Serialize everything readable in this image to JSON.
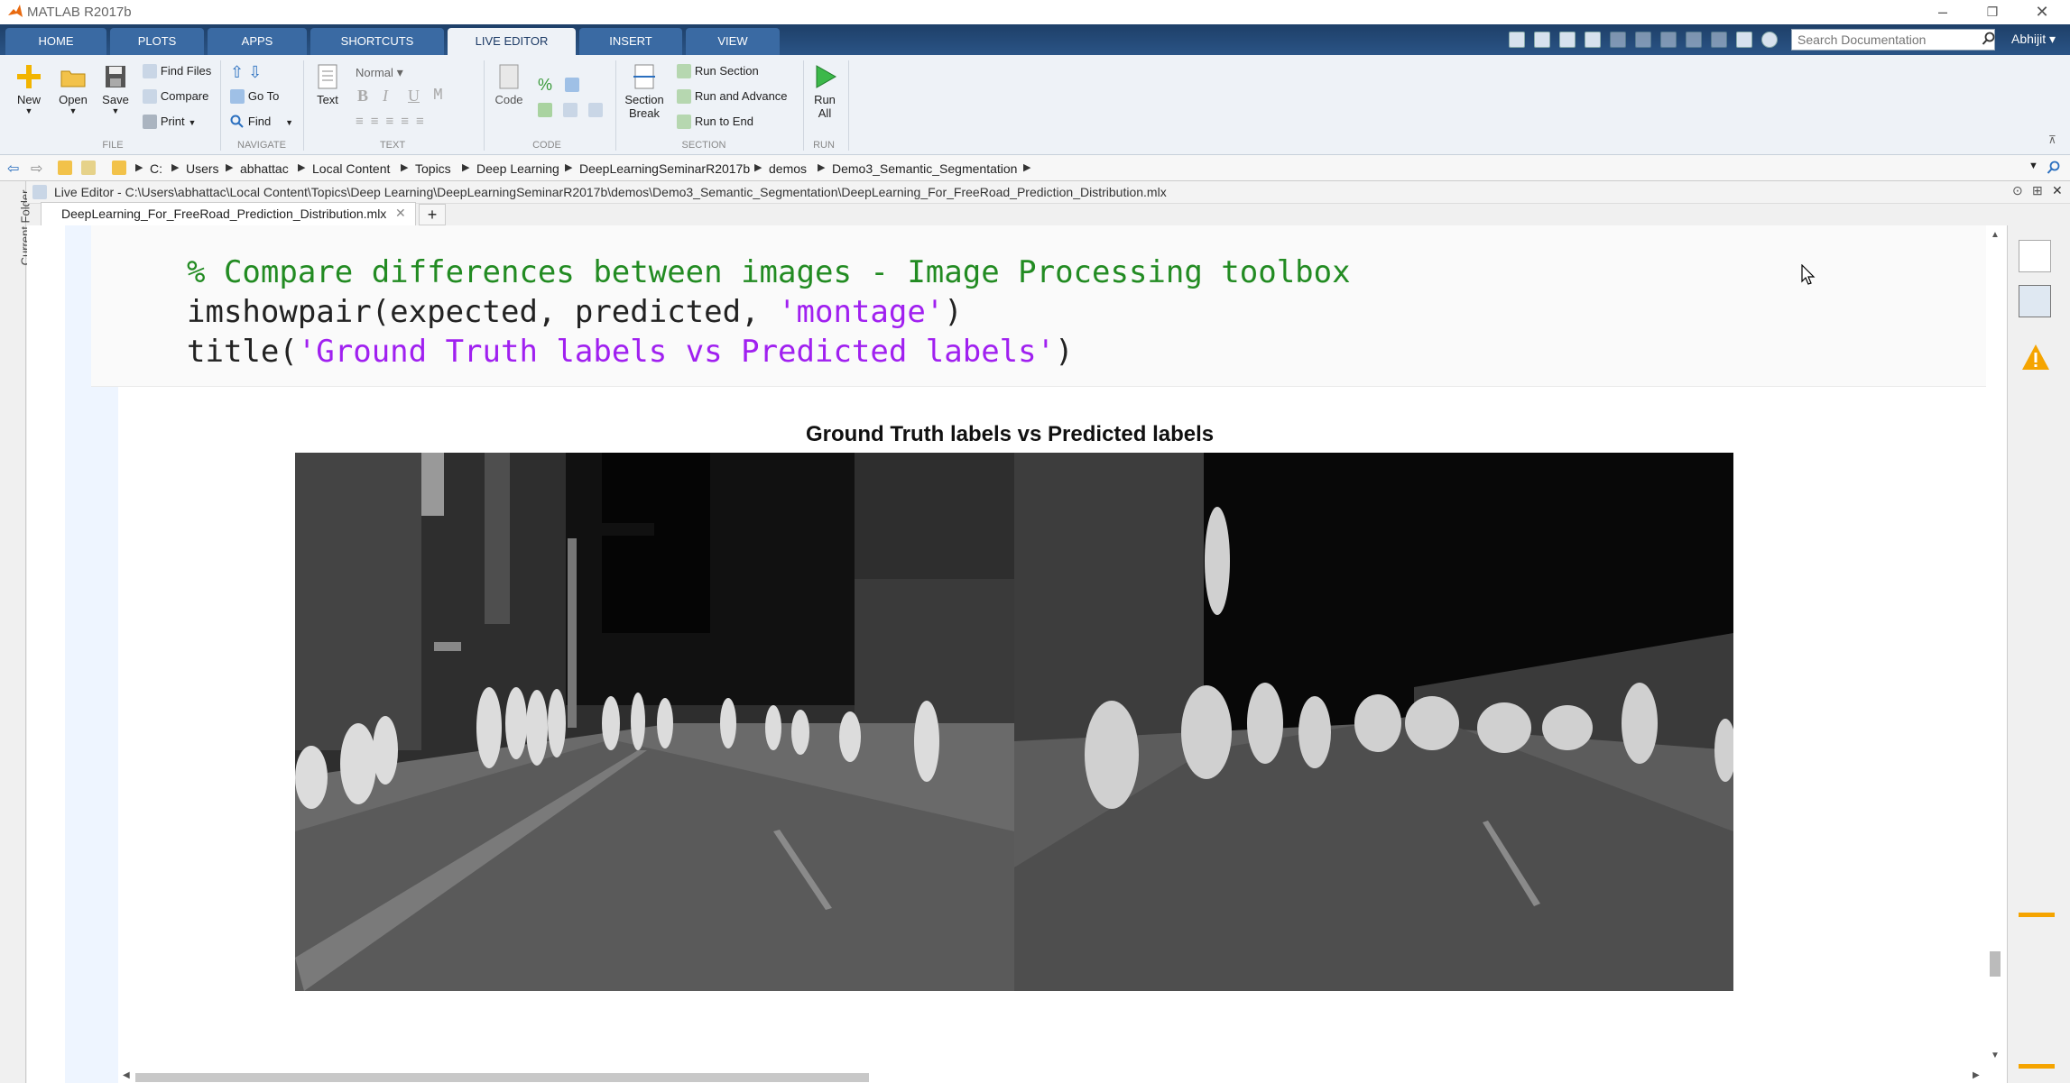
{
  "window": {
    "title": "MATLAB R2017b"
  },
  "tabs": [
    "HOME",
    "PLOTS",
    "APPS",
    "SHORTCUTS",
    "LIVE EDITOR",
    "INSERT",
    "VIEW"
  ],
  "active_tab": "LIVE EDITOR",
  "search": {
    "placeholder": "Search Documentation"
  },
  "user": "Abhijit",
  "ribbon": {
    "file": {
      "label": "FILE",
      "new": "New",
      "open": "Open",
      "save": "Save",
      "find_files": "Find Files",
      "compare": "Compare",
      "print": "Print"
    },
    "navigate": {
      "label": "NAVIGATE",
      "go_to": "Go To",
      "find": "Find"
    },
    "text": {
      "label": "TEXT",
      "text": "Text",
      "style": "Normal",
      "bold": "B",
      "italic": "I",
      "underline": "U",
      "mono": "M"
    },
    "code": {
      "label": "CODE",
      "code": "Code"
    },
    "section": {
      "label": "SECTION",
      "section_break_1": "Section",
      "section_break_2": "Break",
      "run_section": "Run Section",
      "run_and_advance": "Run and Advance",
      "run_to_end": "Run to End"
    },
    "run": {
      "label": "RUN",
      "run_all_1": "Run",
      "run_all_2": "All"
    }
  },
  "address": [
    "C:",
    "Users",
    "abhattac",
    "Local Content",
    "Topics",
    "Deep Learning",
    "DeepLearningSeminarR2017b",
    "demos",
    "Demo3_Semantic_Segmentation"
  ],
  "sidebar": {
    "current_folder": "Current Folder"
  },
  "editor": {
    "header": "Live Editor - C:\\Users\\abhattac\\Local Content\\Topics\\Deep Learning\\DeepLearningSeminarR2017b\\demos\\Demo3_Semantic_Segmentation\\DeepLearning_For_FreeRoad_Prediction_Distribution.mlx",
    "file_tab": "DeepLearning_For_FreeRoad_Prediction_Distribution.mlx",
    "code": {
      "line1": "% Compare differences between images - Image Processing toolbox",
      "line2_a": "imshowpair(expected, predicted, ",
      "line2_str": "'montage'",
      "line2_b": ")",
      "line3_a": "title(",
      "line3_str": "'Ground Truth labels vs Predicted labels'",
      "line3_b": ")"
    },
    "figure_title": "Ground Truth labels vs Predicted labels"
  },
  "colors": {
    "tabbar": "#2a5486",
    "comment": "#228b22",
    "string": "#a020f0",
    "warning": "#f5a400",
    "marker": "#f5a400"
  }
}
